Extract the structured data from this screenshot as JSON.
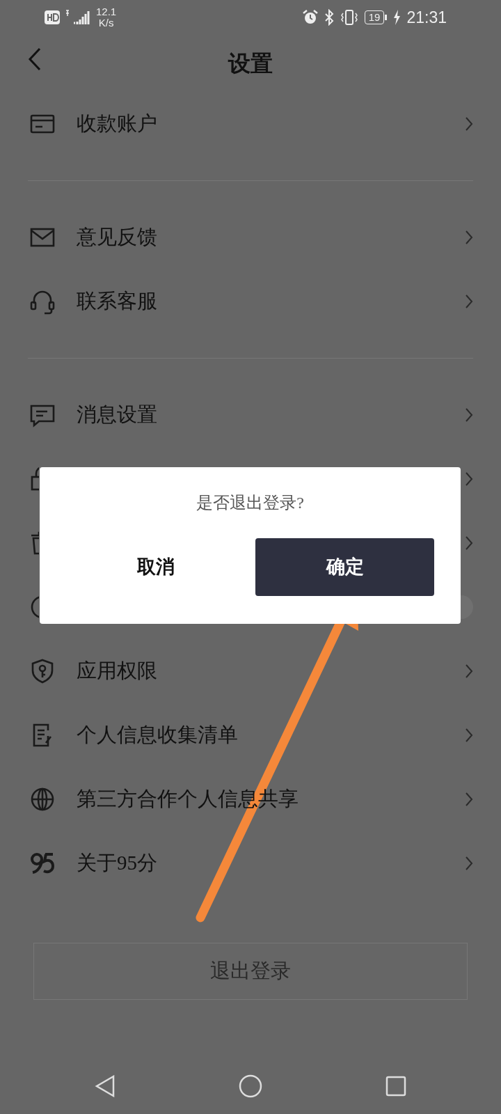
{
  "status_bar": {
    "network_speed": "12.1",
    "network_unit": "K/s",
    "battery": "19",
    "time": "21:31"
  },
  "header": {
    "title": "设置"
  },
  "groups": [
    [
      {
        "kind": "link",
        "label": "收款账户"
      }
    ],
    [
      {
        "kind": "link",
        "label": "意见反馈"
      },
      {
        "kind": "link",
        "label": "联系客服"
      }
    ],
    [
      {
        "kind": "link",
        "label": "消息设置"
      },
      {
        "kind": "covered"
      },
      {
        "kind": "covered"
      },
      {
        "kind": "covered-toggle",
        "on": false
      },
      {
        "kind": "link",
        "label": "应用权限"
      },
      {
        "kind": "link",
        "label": "个人信息收集清单"
      },
      {
        "kind": "link",
        "label": "第三方合作个人信息共享"
      },
      {
        "kind": "link",
        "label": "关于95分"
      }
    ]
  ],
  "logout_button": "退出登录",
  "dialog": {
    "message": "是否退出登录?",
    "buttons": [
      {
        "kind": "plain",
        "label": "取消"
      },
      {
        "kind": "primary",
        "label": "确定"
      }
    ]
  }
}
